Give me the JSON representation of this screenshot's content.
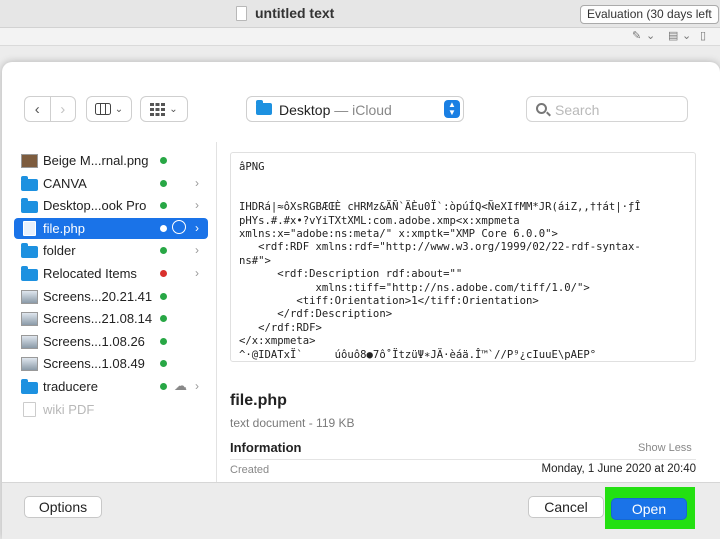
{
  "window": {
    "title": "untitled text",
    "evaluation_badge": "Evaluation (30 days left"
  },
  "dialog": {
    "location": {
      "name": "Desktop",
      "sub": " — iCloud"
    },
    "search": {
      "placeholder": "Search"
    },
    "files": [
      {
        "name": "Beige M...rnal.png",
        "icon": "image-thumbnail-icon",
        "tag": "green",
        "chevron": false,
        "selected": false,
        "dimmed": false
      },
      {
        "name": "CANVA",
        "icon": "folder-icon",
        "tag": "green",
        "chevron": true,
        "selected": false,
        "dimmed": false
      },
      {
        "name": "Desktop...ook Pro",
        "icon": "folder-icon",
        "tag": "green",
        "chevron": true,
        "selected": false,
        "dimmed": false
      },
      {
        "name": "file.php",
        "icon": "document-icon",
        "tag": "white",
        "chevron": true,
        "selected": true,
        "dimmed": false
      },
      {
        "name": "folder",
        "icon": "folder-icon",
        "tag": "green",
        "chevron": true,
        "selected": false,
        "dimmed": false
      },
      {
        "name": "Relocated Items",
        "icon": "folder-icon",
        "tag": "red",
        "chevron": true,
        "selected": false,
        "dimmed": false
      },
      {
        "name": "Screens...20.21.41",
        "icon": "screenshot-thumbnail-icon",
        "tag": "green",
        "chevron": false,
        "selected": false,
        "dimmed": false
      },
      {
        "name": "Screens...21.08.14",
        "icon": "screenshot-thumbnail-icon",
        "tag": "green",
        "chevron": false,
        "selected": false,
        "dimmed": false
      },
      {
        "name": "Screens...1.08.26",
        "icon": "screenshot-thumbnail-icon",
        "tag": "green",
        "chevron": false,
        "selected": false,
        "dimmed": false
      },
      {
        "name": "Screens...1.08.49",
        "icon": "screenshot-thumbnail-icon",
        "tag": "green",
        "chevron": false,
        "selected": false,
        "dimmed": false
      },
      {
        "name": "traducere",
        "icon": "folder-icon",
        "tag": "green",
        "chevron": true,
        "cloud": true,
        "selected": false,
        "dimmed": false
      },
      {
        "name": "wiki PDF",
        "icon": "document-icon",
        "tag": "none",
        "chevron": false,
        "selected": false,
        "dimmed": true
      }
    ],
    "preview": {
      "content": "âPNG\n\n\nIHDRá|≈ôXsRGBÆŒÈ cHRMz&ÄÑ`ÄÈu0Ï`:òpúÍQ<ÑeXIfMM*JR(áiZ,,††át|·ƒÎ\npHYs.#.#x•?vYiTXtXML:com.adobe.xmp<x:xmpmeta\nxmlns:x=\"adobe:ns:meta/\" x:xmptk=\"XMP Core 6.0.0\">\n   <rdf:RDF xmlns:rdf=\"http://www.w3.org/1999/02/22-rdf-syntax-\nns#\">\n      <rdf:Description rdf:about=\"\"\n            xmlns:tiff=\"http://ns.adobe.com/tiff/1.0/\">\n         <tiff:Orientation>1</tiff:Orientation>\n      </rdf:Description>\n   </rdf:RDF>\n</x:xmpmeta>\n^·@IDATxÏ`     úôuô8●7ô˚ÏtzüΨ∗JÄ·èáä.Î™`//P⁹¿cIuuE\\pAEP°"
    },
    "file_info": {
      "name": "file.php",
      "kind": "text document - 119 KB",
      "section_title": "Information",
      "toggle": "Show Less",
      "created_label": "Created",
      "created_value": "Monday, 1 June 2020 at 20:40"
    },
    "buttons": {
      "options": "Options",
      "cancel": "Cancel",
      "open": "Open"
    },
    "colors": {
      "accent": "#1a73e8",
      "highlight": "#23e011",
      "tag_green": "#28a745",
      "tag_red": "#d9302c"
    }
  }
}
